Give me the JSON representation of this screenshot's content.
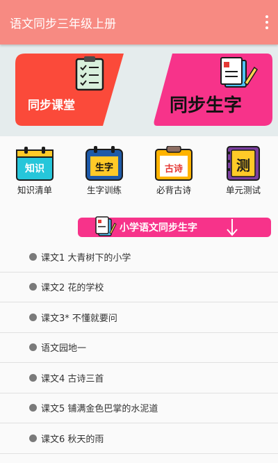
{
  "appbar": {
    "title": "语文同步三年级上册",
    "menu_icon": "more-vertical-icon"
  },
  "banner": {
    "left_card": {
      "label": "同步课堂",
      "color": "#fb4a3a",
      "icon": "checklist-clipboard-icon"
    },
    "right_card": {
      "label": "同步生字",
      "color": "#f7338a",
      "icon": "notebook-pencil-icon"
    }
  },
  "features": [
    {
      "icon_text": "知识",
      "label": "知识清单",
      "icon": "calendar-knowledge-icon"
    },
    {
      "icon_text": "生字",
      "label": "生字训练",
      "icon": "calendar-characters-icon"
    },
    {
      "icon_text": "古诗",
      "label": "必背古诗",
      "icon": "clipboard-poem-icon"
    },
    {
      "icon_text": "测",
      "label": "单元测试",
      "icon": "book-test-icon"
    }
  ],
  "section": {
    "title": "小学语文同步生字",
    "color": "#f7338a",
    "arrow_icon": "arrow-down-icon"
  },
  "lessons": [
    "课文1 大青树下的小学",
    "课文2 花的学校",
    "课文3* 不懂就要问",
    "语文园地一",
    "课文4 古诗三首",
    "课文5 铺满金色巴掌的水泥道",
    "课文6 秋天的雨"
  ]
}
